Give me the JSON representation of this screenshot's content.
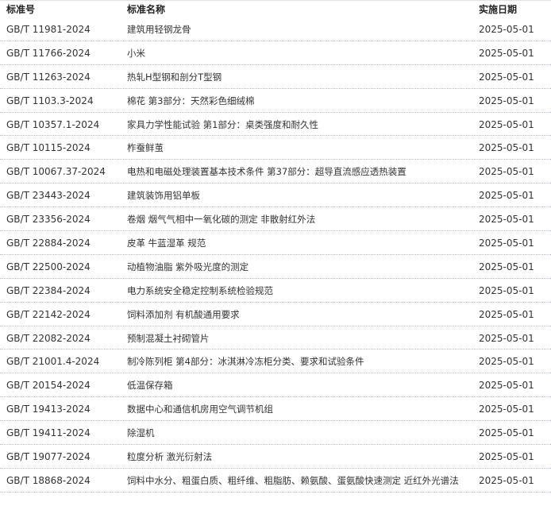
{
  "table": {
    "headers": {
      "code": "标准号",
      "name": "标准名称",
      "date": "实施日期"
    },
    "rows": [
      {
        "code": "GB/T 11981-2024",
        "name": "建筑用轻钢龙骨",
        "date": "2025-05-01"
      },
      {
        "code": "GB/T 11766-2024",
        "name": "小米",
        "date": "2025-05-01"
      },
      {
        "code": "GB/T 11263-2024",
        "name": "热轧H型钢和剖分T型钢",
        "date": "2025-05-01"
      },
      {
        "code": "GB/T 1103.3-2024",
        "name": "棉花 第3部分：天然彩色细绒棉",
        "date": "2025-05-01"
      },
      {
        "code": "GB/T 10357.1-2024",
        "name": "家具力学性能试验 第1部分：桌类强度和耐久性",
        "date": "2025-05-01"
      },
      {
        "code": "GB/T 10115-2024",
        "name": "柞蚕鲜茧",
        "date": "2025-05-01"
      },
      {
        "code": "GB/T 10067.37-2024",
        "name": "电热和电磁处理装置基本技术条件 第37部分：超导直流感应透热装置",
        "date": "2025-05-01"
      },
      {
        "code": "GB/T 23443-2024",
        "name": "建筑装饰用铝单板",
        "date": "2025-05-01"
      },
      {
        "code": "GB/T 23356-2024",
        "name": "卷烟 烟气气相中一氧化碳的测定 非散射红外法",
        "date": "2025-05-01"
      },
      {
        "code": "GB/T 22884-2024",
        "name": "皮革 牛蓝湿革 规范",
        "date": "2025-05-01"
      },
      {
        "code": "GB/T 22500-2024",
        "name": "动植物油脂 紫外吸光度的测定",
        "date": "2025-05-01"
      },
      {
        "code": "GB/T 22384-2024",
        "name": "电力系统安全稳定控制系统检验规范",
        "date": "2025-05-01"
      },
      {
        "code": "GB/T 22142-2024",
        "name": "饲料添加剂 有机酸通用要求",
        "date": "2025-05-01"
      },
      {
        "code": "GB/T 22082-2024",
        "name": "预制混凝土衬砌管片",
        "date": "2025-05-01"
      },
      {
        "code": "GB/T 21001.4-2024",
        "name": "制冷陈列柜 第4部分：冰淇淋冷冻柜分类、要求和试验条件",
        "date": "2025-05-01"
      },
      {
        "code": "GB/T 20154-2024",
        "name": "低温保存箱",
        "date": "2025-05-01"
      },
      {
        "code": "GB/T 19413-2024",
        "name": "数据中心和通信机房用空气调节机组",
        "date": "2025-05-01"
      },
      {
        "code": "GB/T 19411-2024",
        "name": "除湿机",
        "date": "2025-05-01"
      },
      {
        "code": "GB/T 19077-2024",
        "name": "粒度分析 激光衍射法",
        "date": "2025-05-01"
      },
      {
        "code": "GB/T 18868-2024",
        "name": "饲料中水分、粗蛋白质、粗纤维、粗脂肪、赖氨酸、蛋氨酸快速测定 近红外光谱法",
        "date": "2025-05-01"
      }
    ]
  }
}
